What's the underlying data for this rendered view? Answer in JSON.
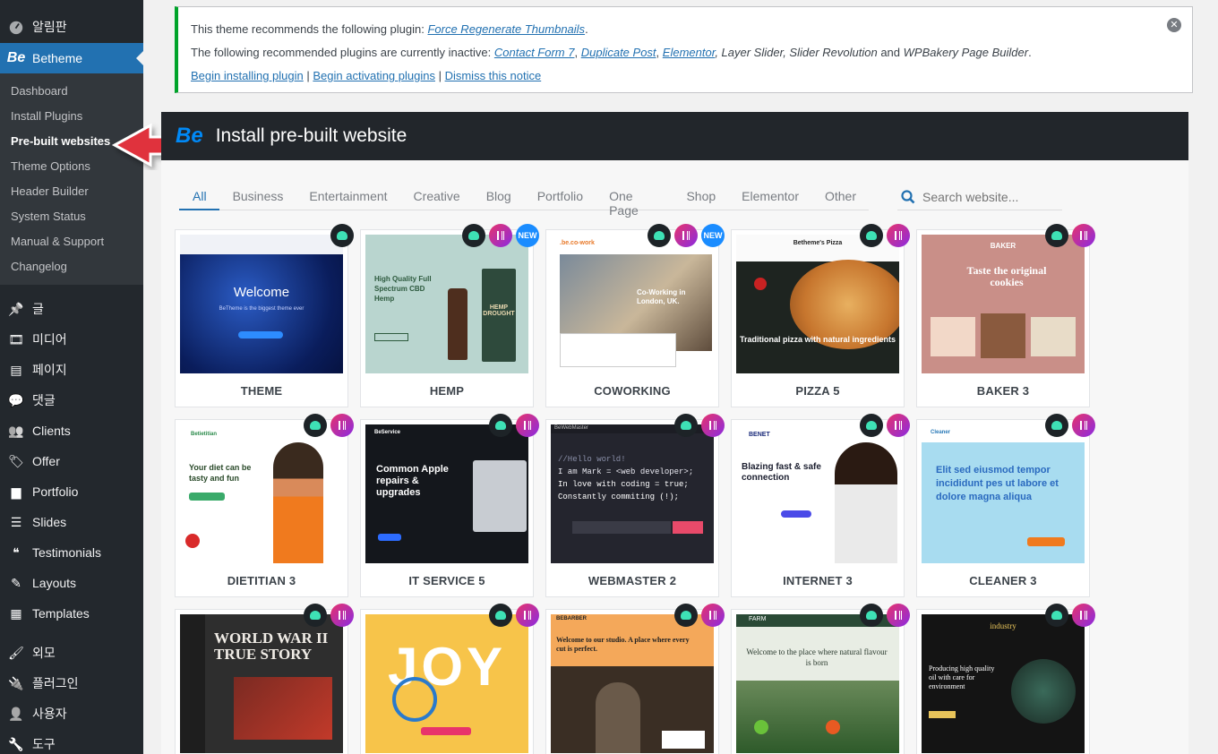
{
  "sidebar": {
    "top_items": [
      {
        "label": "알림판",
        "icon": "dashboard-gauge-icon"
      },
      {
        "label": "Betheme",
        "icon": "be-logo-icon"
      }
    ],
    "submenu": [
      {
        "label": "Dashboard"
      },
      {
        "label": "Install Plugins"
      },
      {
        "label": "Pre-built websites"
      },
      {
        "label": "Theme Options"
      },
      {
        "label": "Header Builder"
      },
      {
        "label": "System Status"
      },
      {
        "label": "Manual & Support"
      },
      {
        "label": "Changelog"
      }
    ],
    "items": [
      {
        "label": "글",
        "icon": "pin-icon"
      },
      {
        "label": "미디어",
        "icon": "media-icon"
      },
      {
        "label": "페이지",
        "icon": "pages-icon"
      },
      {
        "label": "댓글",
        "icon": "comments-icon"
      },
      {
        "label": "Clients",
        "icon": "clients-icon"
      },
      {
        "label": "Offer",
        "icon": "tag-icon"
      },
      {
        "label": "Portfolio",
        "icon": "portfolio-icon"
      },
      {
        "label": "Slides",
        "icon": "slides-icon"
      },
      {
        "label": "Testimonials",
        "icon": "quote-icon"
      },
      {
        "label": "Layouts",
        "icon": "pencil-icon"
      },
      {
        "label": "Templates",
        "icon": "templates-icon"
      }
    ],
    "items2": [
      {
        "label": "외모",
        "icon": "brush-icon"
      },
      {
        "label": "플러그인",
        "icon": "plugin-icon"
      },
      {
        "label": "사용자",
        "icon": "user-icon"
      },
      {
        "label": "도구",
        "icon": "tools-icon"
      }
    ]
  },
  "notice": {
    "line1_prefix": "This theme recommends the following plugin: ",
    "line1_plugin": "Force Regenerate Thumbnails",
    "line1_suffix": ".",
    "line2_prefix": "The following recommended plugins are currently inactive: ",
    "line2_link1": "Contact Form 7",
    "line2_sep1": ", ",
    "line2_link2": "Duplicate Post",
    "line2_sep2": ", ",
    "line2_link3": "Elementor",
    "line2_rest": ", Layer Slider, Slider Revolution",
    "line2_and": " and ",
    "line2_last": "WPBakery Page Builder",
    "line2_end": ".",
    "action1": "Begin installing plugin",
    "action2": "Begin activating plugins",
    "action3": "Dismiss this notice",
    "sep": " | ",
    "close": "✕"
  },
  "header": {
    "logo": "Be",
    "title": "Install pre-built website"
  },
  "tabs": [
    "All",
    "Business",
    "Entertainment",
    "Creative",
    "Blog",
    "Portfolio",
    "One Page",
    "Shop",
    "Elementor",
    "Other"
  ],
  "search": {
    "placeholder": "Search website..."
  },
  "cards": [
    {
      "label": "THEME",
      "badges": [
        "be"
      ]
    },
    {
      "label": "HEMP",
      "badges": [
        "be",
        "el",
        "new"
      ]
    },
    {
      "label": "COWORKING",
      "badges": [
        "be",
        "el",
        "new"
      ]
    },
    {
      "label": "PIZZA 5",
      "badges": [
        "be",
        "el"
      ]
    },
    {
      "label": "BAKER 3",
      "badges": [
        "be",
        "el"
      ]
    },
    {
      "label": "DIETITIAN 3",
      "badges": [
        "be",
        "el"
      ]
    },
    {
      "label": "IT SERVICE 5",
      "badges": [
        "be",
        "el"
      ]
    },
    {
      "label": "WEBMASTER 2",
      "badges": [
        "be",
        "el"
      ]
    },
    {
      "label": "INTERNET 3",
      "badges": [
        "be",
        "el"
      ]
    },
    {
      "label": "CLEANER 3",
      "badges": [
        "be",
        "el"
      ]
    },
    {
      "label": "",
      "badges": [
        "be",
        "el"
      ]
    },
    {
      "label": "",
      "badges": [
        "be",
        "el"
      ]
    },
    {
      "label": "",
      "badges": [
        "be",
        "el"
      ]
    },
    {
      "label": "",
      "badges": [
        "be",
        "el"
      ]
    },
    {
      "label": "",
      "badges": [
        "be",
        "el"
      ]
    }
  ],
  "new_badge": "NEW",
  "thumb_text": {
    "theme_headline": "Welcome",
    "theme_sub": "BeTheme is the biggest theme ever",
    "hemp_headline": "High Quality Full Spectrum CBD Hemp",
    "hemp_label": "HEMP DROUGHT",
    "cowork_logo": ".be.co-work",
    "cowork_headline": "Co-Working in London, UK.",
    "pizza_logo": "Betheme's Pizza",
    "pizza_headline": "Traditional pizza with natural ingredients",
    "baker_logo": "BAKER",
    "baker_headline": "Taste the original cookies",
    "diet_logo": "Betietitian",
    "diet_headline": "Your diet can be tasty and fun",
    "it_logo": "BeService",
    "it_headline": "Common Apple repairs & upgrades",
    "web_logo": "BeWebMaster",
    "web_line1": "//Hello world!",
    "web_line2": "I am Mark = <web developer>;",
    "web_line3": "In love with coding = true;",
    "web_line4": "Constantly commiting (!);",
    "net_logo": "BENET",
    "net_headline": "Blazing fast & safe connection",
    "clean_logo": "Cleaner",
    "clean_headline": "Elit sed eiusmod tempor incididunt pes ut labore et dolore magna aliqua",
    "hist_headline": "WORLD WAR II TRUE STORY",
    "joy_text": "JOY",
    "barber_logo": "BEBARBER",
    "barber_headline": "Welcome to our studio. A place where every cut is perfect.",
    "farm_logo": "FARM",
    "farm_headline": "Welcome to the place where natural flavour is born",
    "ind_logo": "industry",
    "ind_headline": "Producing high quality oil with care for environment"
  }
}
